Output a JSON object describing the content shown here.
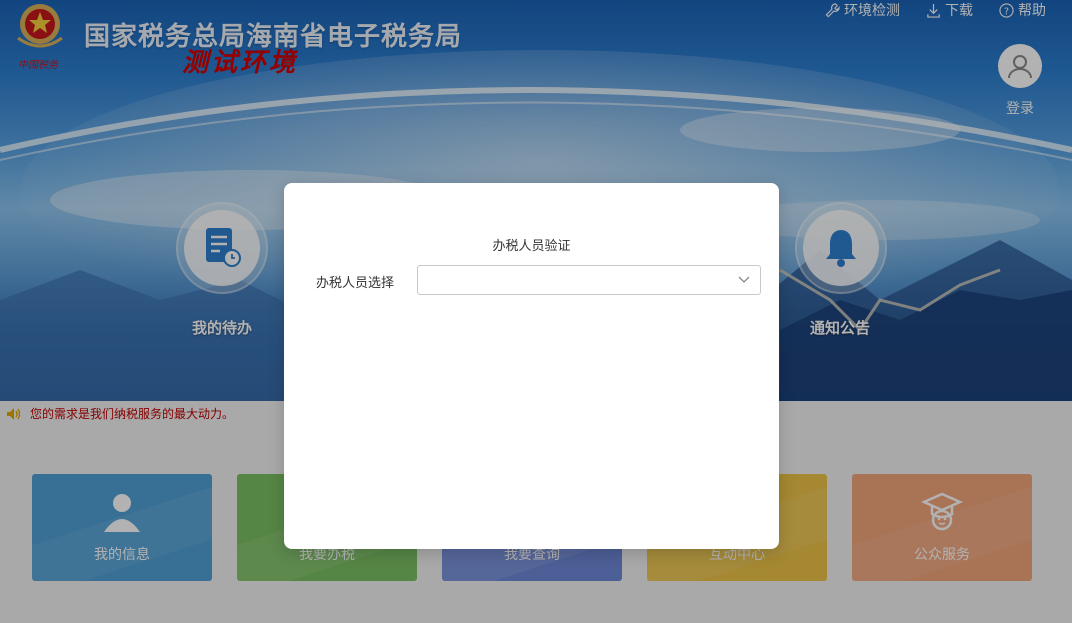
{
  "header": {
    "title": "国家税务总局海南省电子税务局",
    "subtitle": "测试环境",
    "emblem_caption": "中国税务"
  },
  "top_links": [
    {
      "label": "环境检测",
      "icon": "wrench-icon"
    },
    {
      "label": "下载",
      "icon": "download-icon"
    },
    {
      "label": "帮助",
      "icon": "help-circle-icon"
    }
  ],
  "login": {
    "label": "登录",
    "icon": "user-icon"
  },
  "hero_shortcuts": [
    {
      "label": "我的待办",
      "icon": "todo-document-icon"
    },
    {
      "label": "通知公告",
      "icon": "bell-icon"
    }
  ],
  "notice": {
    "text": "您的需求是我们纳税服务的最大动力。",
    "icon": "speaker-icon"
  },
  "cards": [
    {
      "label": "我的信息",
      "icon": "user-icon",
      "color": "#4f9fd6"
    },
    {
      "label": "我要办税",
      "icon": "tax-icon",
      "color": "#7cc063"
    },
    {
      "label": "我要查询",
      "icon": "search-icon",
      "color": "#6f89d8"
    },
    {
      "label": "互动中心",
      "icon": "chat-icon",
      "color": "#ecc347"
    },
    {
      "label": "公众服务",
      "icon": "graduate-icon",
      "color": "#f2a57a"
    }
  ],
  "modal": {
    "title": "办税人员验证",
    "field_label": "办税人员选择",
    "select_value": ""
  },
  "colors": {
    "brand_blue": "#1b63b6",
    "warning_red": "#d40000",
    "notice_red": "#c00000"
  }
}
